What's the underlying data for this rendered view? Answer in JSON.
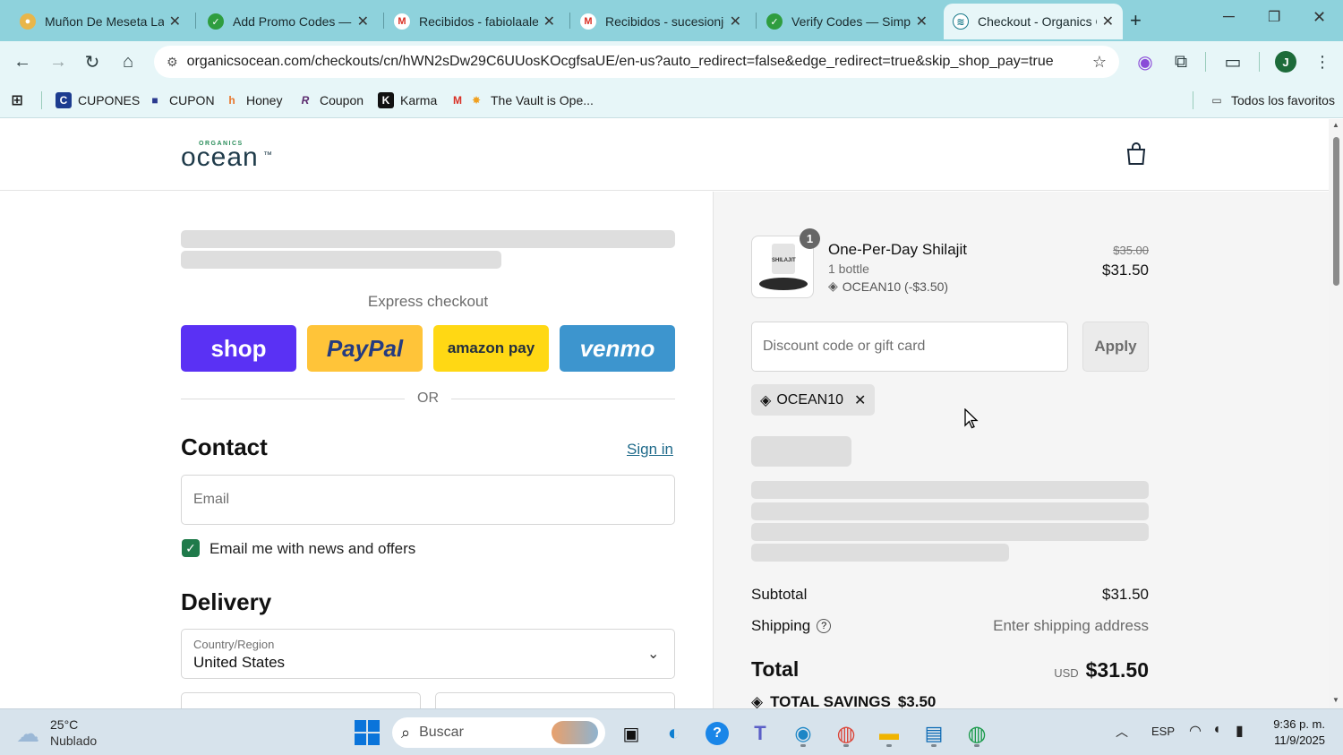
{
  "browser": {
    "tabs": [
      {
        "title": "Muñon De Meseta Lar",
        "icon": "generic-favicon"
      },
      {
        "title": "Add Promo Codes —",
        "icon": "leaf-check-favicon"
      },
      {
        "title": "Recibidos - fabiolaalej",
        "icon": "gmail-favicon"
      },
      {
        "title": "Recibidos - sucesionjc",
        "icon": "gmail-favicon"
      },
      {
        "title": "Verify Codes — Simpl",
        "icon": "leaf-check-favicon"
      },
      {
        "title": "Checkout - Organics C",
        "icon": "shopify-favicon"
      }
    ],
    "url": "organicsocean.com/checkouts/cn/hWN2sDw29C6UUosKOcgfsaUE/en-us?auto_redirect=false&edge_redirect=true&skip_shop_pay=true",
    "bookmarks": [
      {
        "label": "CUPONES"
      },
      {
        "label": "CUPON"
      },
      {
        "label": "Honey"
      },
      {
        "label": "Coupon"
      },
      {
        "label": "Karma"
      },
      {
        "label": "The Vault is Ope..."
      }
    ],
    "all_bookmarks_label": "Todos los favoritos",
    "profile_initial": "J"
  },
  "store": {
    "logo_small": "ORGANICS",
    "logo_main": "ocean",
    "logo_tm": "™"
  },
  "checkout": {
    "express_title": "Express checkout",
    "express_buttons": [
      "shop",
      "PayPal",
      "amazon pay",
      "venmo"
    ],
    "or_label": "OR",
    "contact_title": "Contact",
    "sign_in": "Sign in",
    "email_placeholder": "Email",
    "newsletter_label": "Email me with news and offers",
    "newsletter_checked": true,
    "delivery_title": "Delivery",
    "country_label": "Country/Region",
    "country_value": "United States"
  },
  "summary": {
    "item": {
      "quantity": "1",
      "name": "One-Per-Day Shilajit",
      "variant": "1 bottle",
      "discount": "OCEAN10 (-$3.50)",
      "original_price": "$35.00",
      "price": "$31.50",
      "thumb_label": "SHILAJIT"
    },
    "discount_placeholder": "Discount code or gift card",
    "apply_label": "Apply",
    "applied_code": "OCEAN10",
    "subtotal_label": "Subtotal",
    "subtotal_value": "$31.50",
    "shipping_label": "Shipping",
    "shipping_value": "Enter shipping address",
    "total_label": "Total",
    "total_currency": "USD",
    "total_value": "$31.50",
    "savings_label": "TOTAL SAVINGS",
    "savings_value": "$3.50"
  },
  "taskbar": {
    "weather_temp": "25°C",
    "weather_desc": "Nublado",
    "search_placeholder": "Buscar",
    "language": "ESP",
    "time": "9:36 p. m.",
    "date": "11/9/2025"
  },
  "colors": {
    "tabbar_bg": "#8ed2dc",
    "shop_purple": "#5a31f4",
    "paypal_yellow": "#ffc439",
    "amazon_yellow": "#ffd814",
    "venmo_blue": "#3d95ce",
    "checkbox_green": "#1f7a4a"
  }
}
